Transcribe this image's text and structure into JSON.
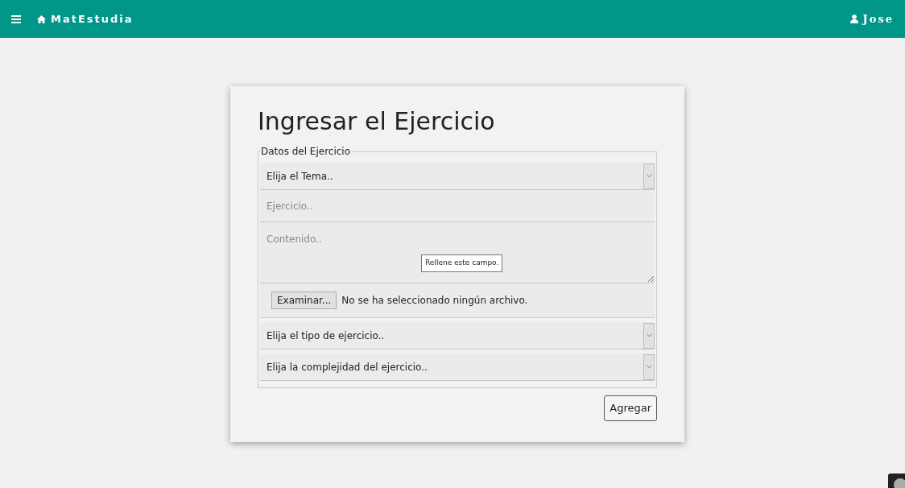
{
  "navbar": {
    "brand": "MatEstudia",
    "user": "Jose"
  },
  "form": {
    "title": "Ingresar el Ejercicio",
    "legend": "Datos del Ejercicio",
    "fields": [
      {
        "kind": "select",
        "value": "Elija el Tema.."
      },
      {
        "kind": "text",
        "placeholder": "Ejercicio.."
      },
      {
        "kind": "textarea",
        "placeholder": "Contenido..",
        "tooltip": "Rellene este campo."
      },
      {
        "kind": "file",
        "button": "Examinar...",
        "status": "No se ha seleccionado ningún archivo."
      },
      {
        "kind": "select",
        "value": "Elija el tipo de ejercicio.."
      },
      {
        "kind": "select",
        "value": "Elija la complejidad del ejercicio.."
      }
    ],
    "submit": "Agregar"
  }
}
